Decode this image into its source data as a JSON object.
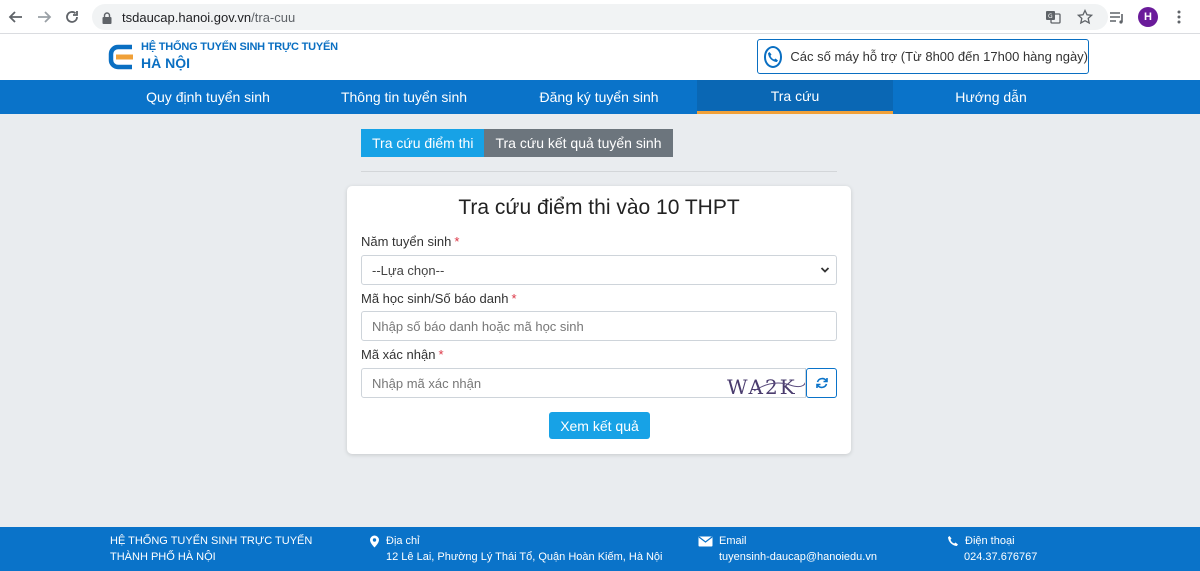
{
  "browser": {
    "url_host": "tsdaucap.hanoi.gov.vn",
    "url_path": "/tra-cuu",
    "profile_initial": "H",
    "icons": [
      "back-icon",
      "forward-icon",
      "reload-icon",
      "lock-icon",
      "translate-icon",
      "star-icon",
      "reading-list-icon"
    ]
  },
  "header": {
    "logo_line1": "HỆ THỐNG TUYỂN SINH TRỰC TUYẾN",
    "logo_line2": "HÀ NỘI",
    "support_text": "Các số máy hỗ trợ (Từ 8h00 đến 17h00 hàng ngày)",
    "brand_color": "#0a73c9",
    "accent_color": "#f0a038"
  },
  "nav": {
    "items": [
      {
        "label": "Quy định tuyển sinh"
      },
      {
        "label": "Thông tin tuyển sinh"
      },
      {
        "label": "Đăng ký tuyển sinh"
      },
      {
        "label": "Tra cứu",
        "active": true
      },
      {
        "label": "Hướng dẫn"
      }
    ]
  },
  "tabs": {
    "exam_scores": "Tra cứu điểm thi",
    "admission_results": "Tra cứu kết quả tuyển sinh"
  },
  "form": {
    "title": "Tra cứu điểm thi vào 10 THPT",
    "year_label": "Năm tuyển sinh",
    "year_value": "--Lựa chọn--",
    "student_id_label": "Mã học sinh/Số báo danh",
    "student_id_placeholder": "Nhập số báo danh hoặc mã học sinh",
    "captcha_label": "Mã xác nhận",
    "captcha_placeholder": "Nhập mã xác nhận",
    "captcha_text": "WA2K",
    "required_mark": "*",
    "submit_label": "Xem kết quả"
  },
  "footer": {
    "org": "HỆ THỐNG TUYỂN SINH TRỰC TUYẾN THÀNH PHỐ HÀ NỘI",
    "address_label": "Địa chỉ",
    "address_value": "12 Lê Lai, Phường Lý Thái Tổ, Quận Hoàn Kiếm, Hà Nội",
    "email_label": "Email",
    "email_value": "tuyensinh-daucap@hanoiedu.vn",
    "phone_label": "Điện thoại",
    "phone_value": "024.37.676767"
  }
}
